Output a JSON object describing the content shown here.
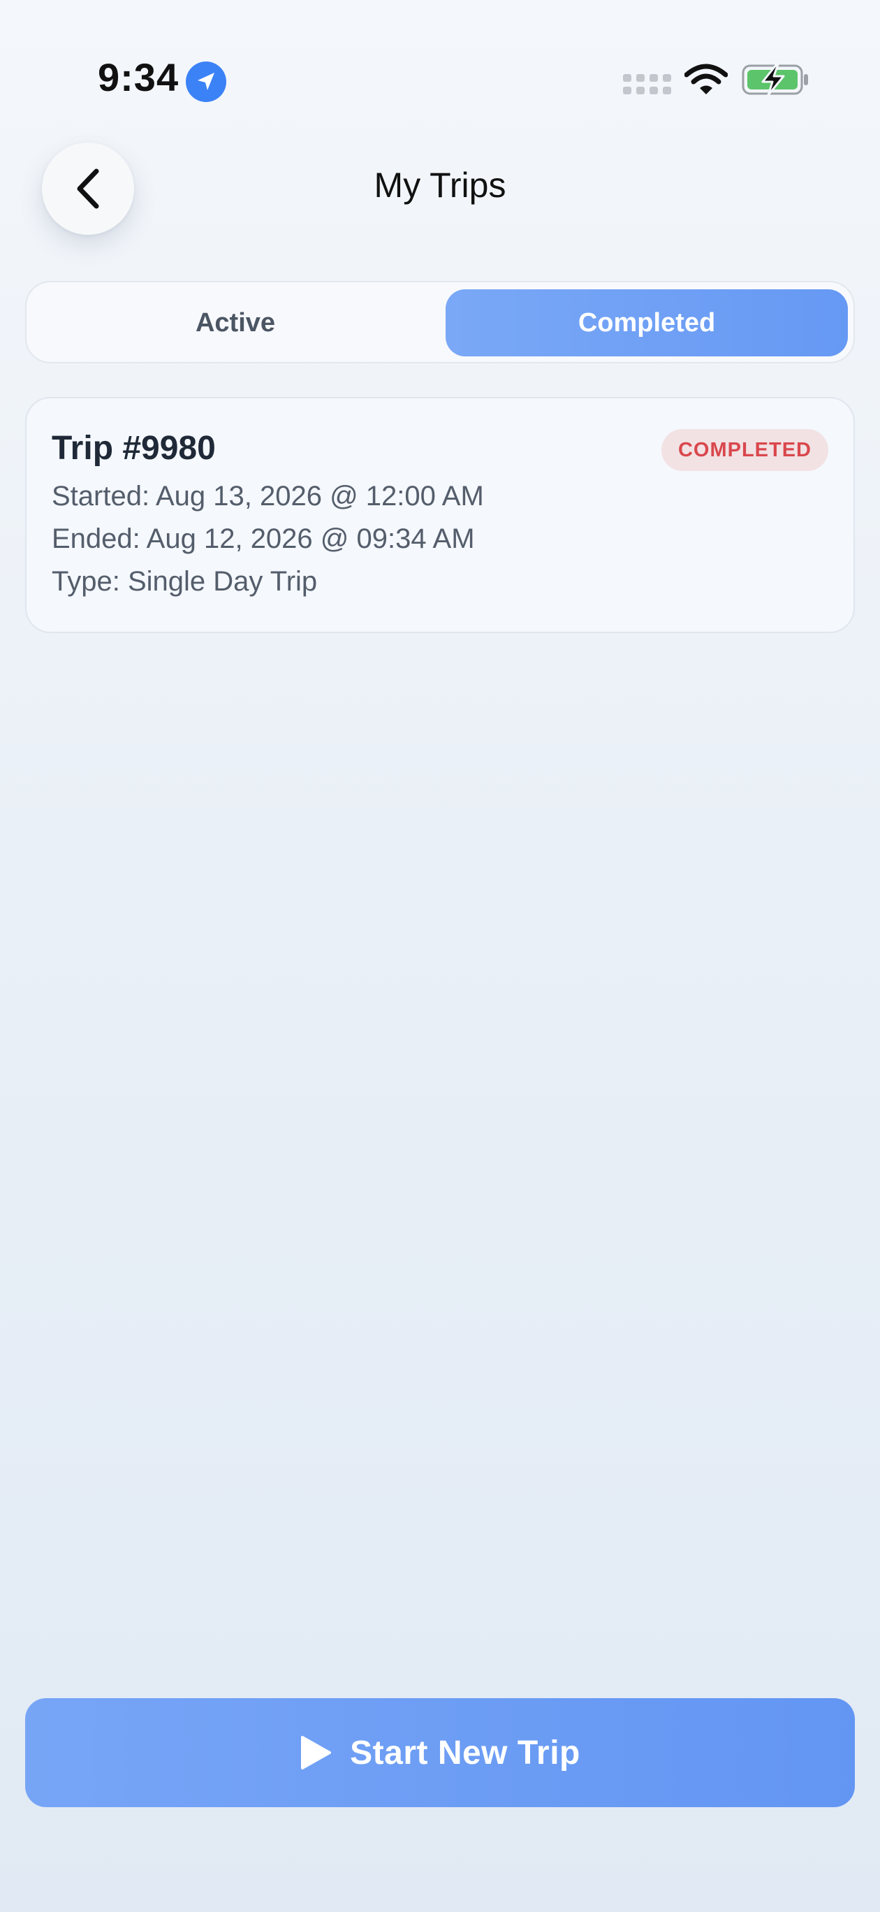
{
  "status_bar": {
    "time": "9:34",
    "icons": [
      "location-arrow-icon",
      "cellular-signal-icon",
      "wifi-icon",
      "battery-charging-icon"
    ]
  },
  "header": {
    "back_icon": "chevron-left-icon",
    "title": "My Trips"
  },
  "tabs": [
    {
      "label": "Active",
      "selected": false
    },
    {
      "label": "Completed",
      "selected": true
    }
  ],
  "trips": [
    {
      "title": "Trip #9980",
      "status": "COMPLETED",
      "started": "Started: Aug 13, 2026 @ 12:00 AM",
      "ended": "Ended: Aug 12, 2026 @ 09:34 AM",
      "type": "Type: Single Day Trip"
    }
  ],
  "footer": {
    "start_button_label": "Start New Trip",
    "start_button_icon": "play-icon"
  },
  "colors": {
    "accent": "#6a9cf5",
    "badge_text": "#d9484d",
    "badge_bg": "#f2e2e4",
    "location_icon": "#3b82f6",
    "battery_fill": "#5cc46a"
  }
}
